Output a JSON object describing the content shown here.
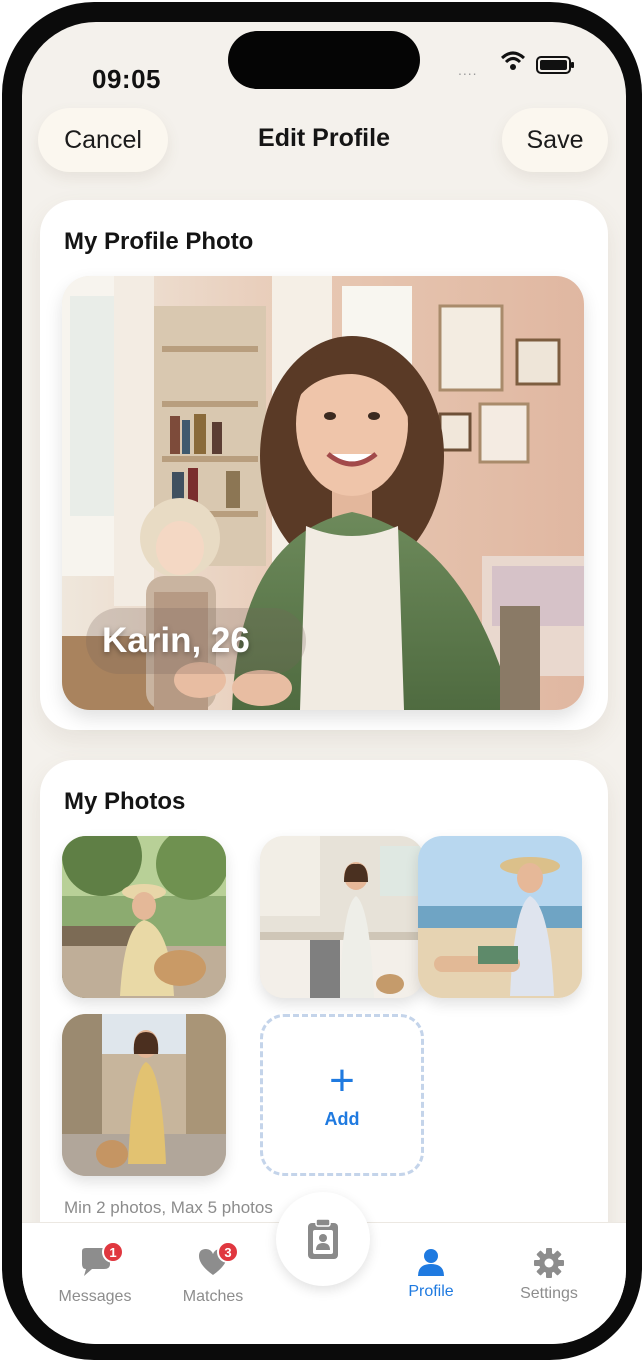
{
  "status_bar": {
    "time": "09:05",
    "signal": "...."
  },
  "header": {
    "cancel_label": "Cancel",
    "title": "Edit Profile",
    "save_label": "Save"
  },
  "profile_photo_card": {
    "title": "My Profile Photo",
    "name_age": "Karin, 26"
  },
  "photos_card": {
    "title": "My Photos",
    "add_label": "Add",
    "hint": "Min 2 photos, Max 5 photos",
    "photos": [
      "park-bench-dog",
      "kitchen-cooking",
      "beach-sunhat",
      "street-dress-dog"
    ]
  },
  "tab_bar": {
    "tabs": [
      {
        "label": "Messages",
        "icon": "chat-bubble-icon",
        "badge": "1",
        "active": false
      },
      {
        "label": "Matches",
        "icon": "heart-icon",
        "badge": "3",
        "active": false
      },
      {
        "label": "",
        "icon": "id-card-icon",
        "badge": "",
        "active": false
      },
      {
        "label": "Profile",
        "icon": "person-icon",
        "badge": "",
        "active": true
      },
      {
        "label": "Settings",
        "icon": "gear-icon",
        "badge": "",
        "active": false
      }
    ]
  },
  "colors": {
    "accent": "#1f7ae0",
    "badge": "#e0373f",
    "background": "#f4f1ec"
  }
}
